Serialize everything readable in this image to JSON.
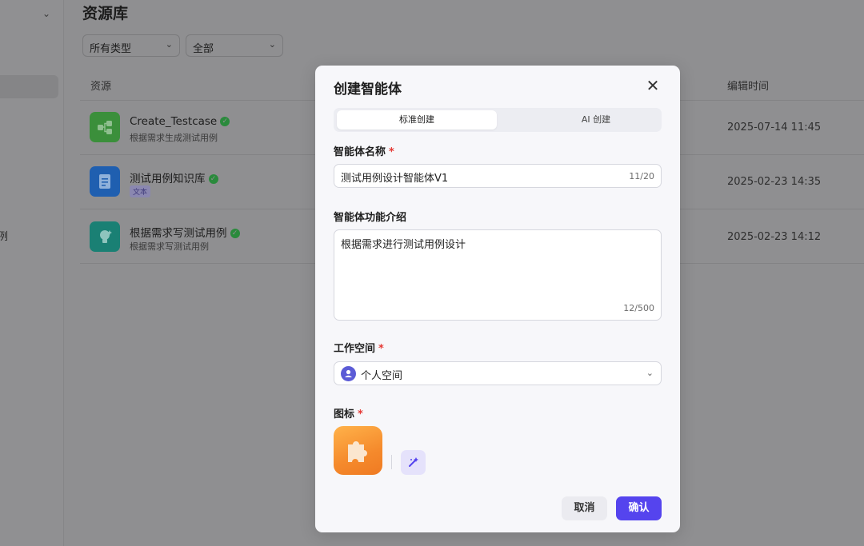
{
  "page": {
    "title": "资源库",
    "filters": {
      "type_select": "所有类型",
      "scope_select": "全部"
    },
    "columns": {
      "resource": "资源",
      "edited_time": "编辑时间"
    },
    "sidebar": {
      "truncated_text": "例"
    },
    "resources": [
      {
        "name": "Create_Testcase",
        "desc": "根据需求生成测试用例",
        "tag": "",
        "time": "2025-07-14 11:45",
        "icon": "workflow-icon",
        "color": "#3b8f3b"
      },
      {
        "name": "测试用例知识库",
        "desc": "",
        "tag": "文本",
        "time": "2025-02-23 14:35",
        "icon": "document-icon",
        "color": "#1f5fb0"
      },
      {
        "name": "根据需求写测试用例",
        "desc": "根据需求写测试用例",
        "tag": "",
        "time": "2025-02-23 14:12",
        "icon": "lightbulb-icon",
        "color": "#1a8074"
      }
    ]
  },
  "modal": {
    "title": "创建智能体",
    "tabs": [
      "标准创建",
      "AI 创建"
    ],
    "active_tab": "标准创建",
    "name_label": "智能体名称",
    "name_value": "测试用例设计智能体V1",
    "name_count": "11/20",
    "desc_label": "智能体功能介绍",
    "desc_value": "根据需求进行测试用例设计",
    "desc_count": "12/500",
    "workspace_label": "工作空间",
    "workspace_value": "个人空间",
    "icon_label": "图标",
    "required_mark": "*",
    "cancel": "取消",
    "confirm": "确认",
    "colors": {
      "accent": "#5544ee",
      "required": "#e53935",
      "icon_orange": "#f58a2c"
    }
  }
}
